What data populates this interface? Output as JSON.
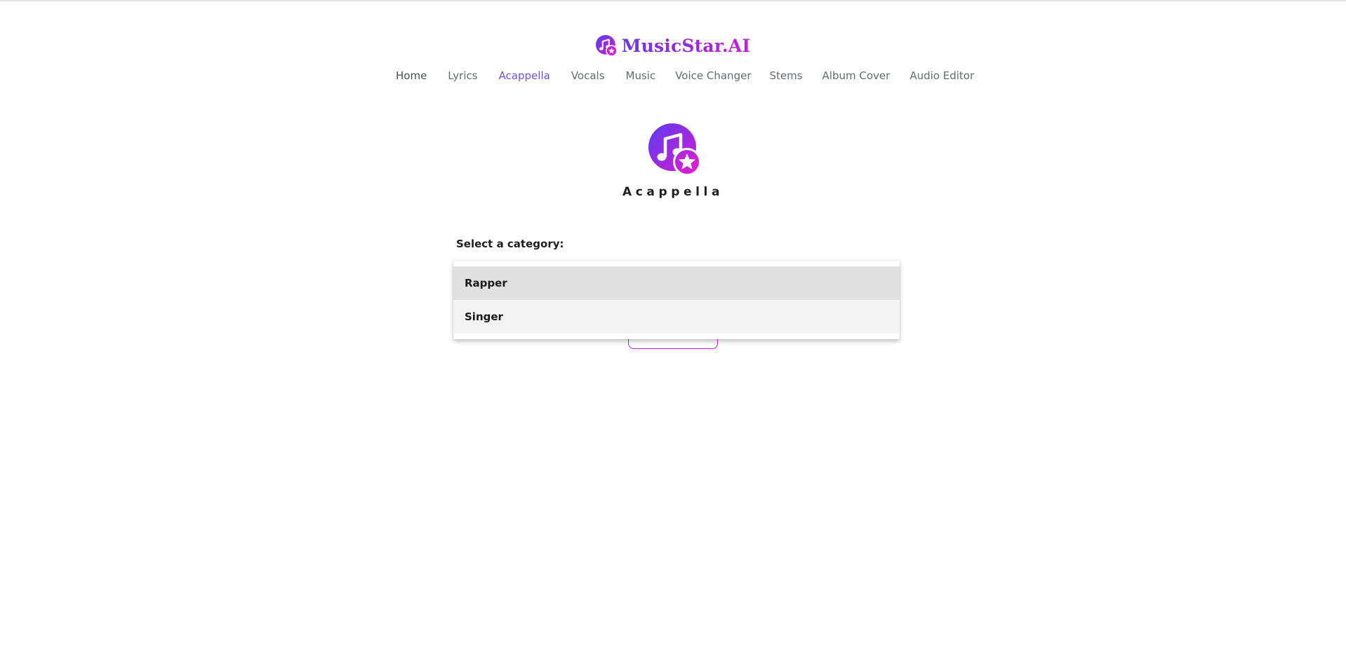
{
  "brand": {
    "name": "MusicStar.AI",
    "icon": "music-note-star-icon",
    "gradient_start": "#6a35e6",
    "gradient_end": "#c51fd6"
  },
  "nav": {
    "items": [
      {
        "label": "Home"
      },
      {
        "label": "Lyrics"
      },
      {
        "label": "Acappella"
      },
      {
        "label": "Vocals"
      },
      {
        "label": "Music"
      },
      {
        "label": "Voice Changer"
      },
      {
        "label": "Stems"
      },
      {
        "label": "Album Cover"
      },
      {
        "label": "Audio Editor"
      }
    ],
    "active": "Acappella",
    "active_color": "#7051df"
  },
  "hero": {
    "icon": "music-note-star-icon",
    "title": "Acappella"
  },
  "form": {
    "category_label": "Select a category:",
    "dropdown": {
      "options": [
        {
          "label": "Rapper",
          "state": "hover"
        },
        {
          "label": "Singer",
          "state": "normal"
        }
      ]
    }
  }
}
